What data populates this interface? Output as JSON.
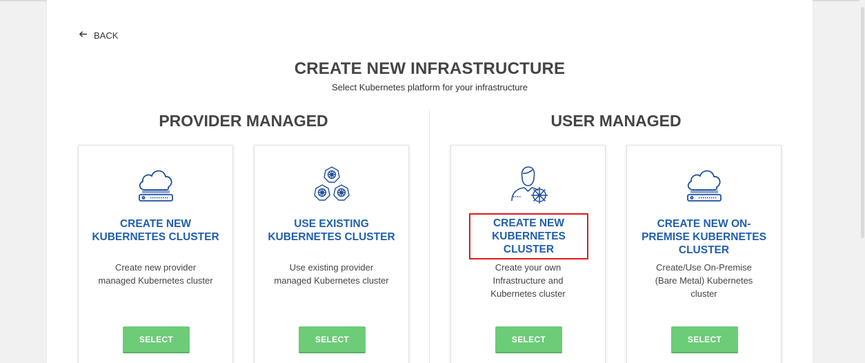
{
  "nav": {
    "back_label": "BACK"
  },
  "header": {
    "title": "CREATE NEW INFRASTRUCTURE",
    "subtitle": "Select Kubernetes platform for your infrastructure"
  },
  "sections": [
    {
      "title": "PROVIDER MANAGED"
    },
    {
      "title": "USER MANAGED"
    }
  ],
  "cards": [
    {
      "icon": "cloud-server-icon",
      "title_lines": [
        "CREATE NEW",
        "KUBERNETES CLUSTER"
      ],
      "desc_lines": [
        "Create new provider",
        "managed Kubernetes cluster"
      ],
      "button": "SELECT"
    },
    {
      "icon": "kubernetes-cluster-icon",
      "title_lines": [
        "USE EXISTING",
        "KUBERNETES CLUSTER"
      ],
      "desc_lines": [
        "Use existing provider",
        "managed Kubernetes cluster"
      ],
      "button": "SELECT"
    },
    {
      "icon": "user-kubernetes-icon",
      "title_lines": [
        "CREATE NEW",
        "KUBERNETES CLUSTER"
      ],
      "desc_lines": [
        "Create your own",
        "Infrastructure and",
        "Kubernetes cluster"
      ],
      "button": "SELECT"
    },
    {
      "icon": "cloud-server-icon",
      "title_lines": [
        "CREATE NEW ON-",
        "PREMISE KUBERNETES",
        "CLUSTER"
      ],
      "desc_lines": [
        "Create/Use On-Premise",
        "(Bare Metal) Kubernetes",
        "cluster"
      ],
      "button": "SELECT"
    }
  ],
  "colors": {
    "title_blue": "#1f5fb0",
    "button_green": "#6ccc78",
    "highlight_red": "#e0191e",
    "icon_blue": "#1f4fa0"
  }
}
